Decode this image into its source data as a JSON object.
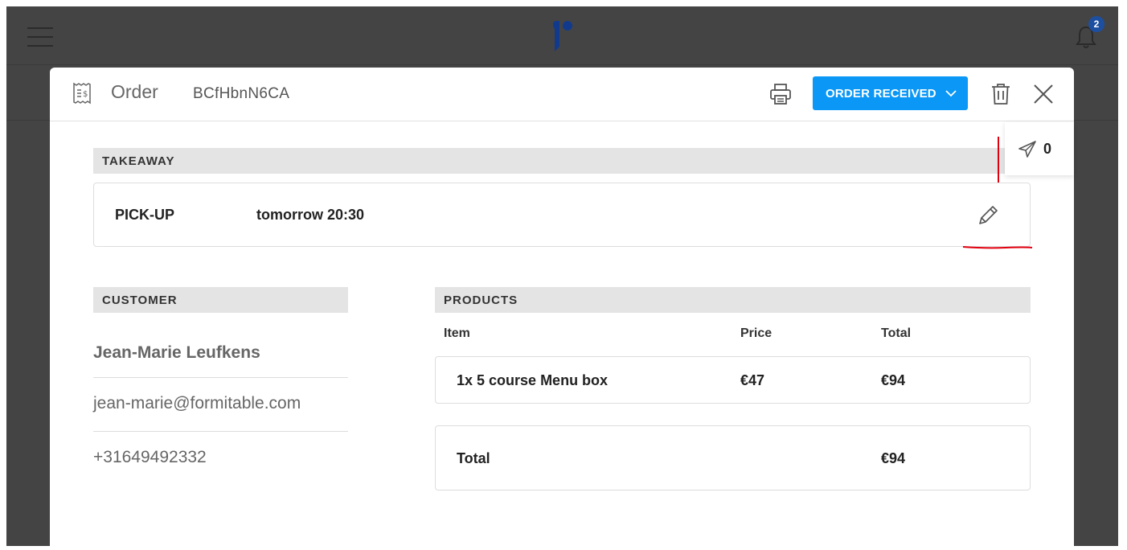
{
  "app": {
    "notification_count": "2"
  },
  "order": {
    "title": "Order",
    "code": "BCfHbnN6CA",
    "status_label": "ORDER RECEIVED"
  },
  "takeaway": {
    "section_title": "TAKEAWAY",
    "pickup_label": "PICK-UP",
    "pickup_time": "tomorrow 20:30",
    "sent_count": "0"
  },
  "customer": {
    "section_title": "CUSTOMER",
    "name": "Jean-Marie Leufkens",
    "email": "jean-marie@formitable.com",
    "phone": "+31649492332"
  },
  "products": {
    "section_title": "PRODUCTS",
    "columns": [
      "Item",
      "Price",
      "Total"
    ],
    "rows": [
      {
        "item": "1x 5 course Menu box",
        "price": "€47",
        "total": "€94"
      }
    ],
    "total_label": "Total",
    "total_value": "€94"
  },
  "colors": {
    "accent": "#0a97f5",
    "badge": "#1d4fa0",
    "annotation": "#e2000f"
  },
  "icons": [
    "menu-icon",
    "logo",
    "bell-icon",
    "receipt-icon",
    "printer-icon",
    "chevron-down-icon",
    "trash-icon",
    "close-icon",
    "send-icon",
    "pencil-icon"
  ]
}
